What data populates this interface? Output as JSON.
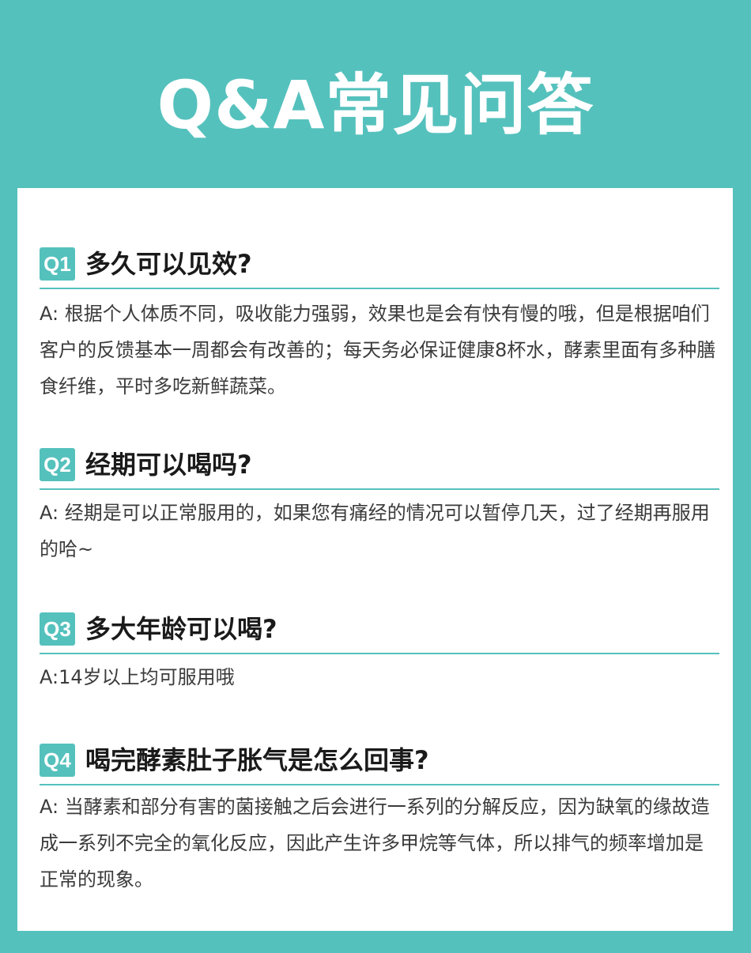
{
  "header": {
    "title": "Q&A常见问答"
  },
  "faq": [
    {
      "badge": "Q1",
      "question": "多久可以见效?",
      "answer": "A: 根据个人体质不同，吸收能力强弱，效果也是会有快有慢的哦，但是根据咱们客户的反馈基本一周都会有改善的；每天务必保证健康8杯水，酵素里面有多种膳食纤维，平时多吃新鲜蔬菜。"
    },
    {
      "badge": "Q2",
      "question": "经期可以喝吗?",
      "answer": "A: 经期是可以正常服用的，如果您有痛经的情况可以暂停几天，过了经期再服用的哈~"
    },
    {
      "badge": "Q3",
      "question": "多大年龄可以喝?",
      "answer": "A:14岁以上均可服用哦"
    },
    {
      "badge": "Q4",
      "question": "喝完酵素肚子胀气是怎么回事?",
      "answer": "A: 当酵素和部分有害的菌接触之后会进行一系列的分解反应，因为缺氧的缘故造成一系列不完全的氧化反应，因此产生许多甲烷等气体，所以排气的频率增加是正常的现象。"
    }
  ],
  "colors": {
    "accent": "#55c1bd",
    "card": "#ffffff",
    "question_text": "#1a1a1a",
    "answer_text": "#3b3b3b"
  }
}
